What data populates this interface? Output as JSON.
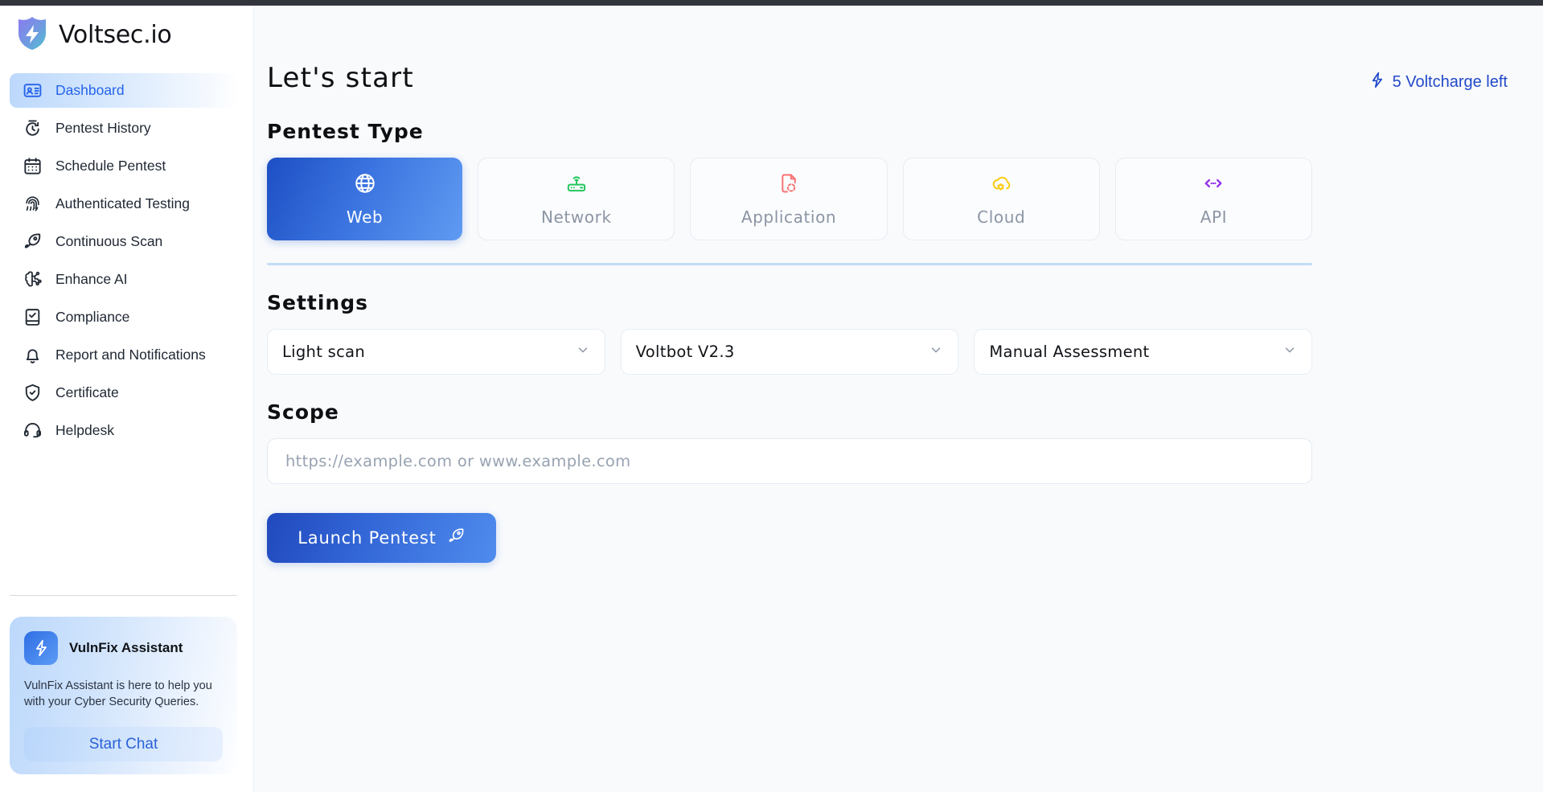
{
  "brand": {
    "name": "Voltsec.io",
    "logo_icon": "shield-bolt-logo"
  },
  "sidebar": {
    "items": [
      {
        "label": "Dashboard",
        "icon": "id-card-icon",
        "active": true
      },
      {
        "label": "Pentest History",
        "icon": "history-clock-icon",
        "active": false
      },
      {
        "label": "Schedule Pentest",
        "icon": "calendar-icon",
        "active": false
      },
      {
        "label": "Authenticated Testing",
        "icon": "fingerprint-icon",
        "active": false
      },
      {
        "label": "Continuous Scan",
        "icon": "rocket-icon",
        "active": false
      },
      {
        "label": "Enhance AI",
        "icon": "brain-circuit-icon",
        "active": false
      },
      {
        "label": "Compliance",
        "icon": "checklist-book-icon",
        "active": false
      },
      {
        "label": "Report and Notifications",
        "icon": "bell-icon",
        "active": false
      },
      {
        "label": "Certificate",
        "icon": "shield-check-icon",
        "active": false
      },
      {
        "label": "Helpdesk",
        "icon": "headset-icon",
        "active": false
      }
    ],
    "assistant": {
      "icon": "bolt-icon",
      "title": "VulnFix Assistant",
      "description": "VulnFix Assistant is here to help you with your Cyber Security Queries.",
      "button_label": "Start Chat"
    }
  },
  "header": {
    "title": "Let's start",
    "voltcharge_label": "5 Voltcharge left",
    "voltcharge_icon": "bolt-icon"
  },
  "pentest_type": {
    "section_title": "Pentest Type",
    "options": [
      {
        "label": "Web",
        "icon": "globe-icon",
        "color": "#ffffff",
        "selected": true
      },
      {
        "label": "Network",
        "icon": "router-wifi-icon",
        "color": "#22c55e",
        "selected": false
      },
      {
        "label": "Application",
        "icon": "file-scan-icon",
        "color": "#f87171",
        "selected": false
      },
      {
        "label": "Cloud",
        "icon": "cloud-cog-icon",
        "color": "#facc15",
        "selected": false
      },
      {
        "label": "API",
        "icon": "code-brackets-icon",
        "color": "#9333ea",
        "selected": false
      }
    ]
  },
  "settings": {
    "section_title": "Settings",
    "selects": [
      {
        "name": "scan-intensity",
        "value": "Light scan"
      },
      {
        "name": "bot-version",
        "value": "Voltbot V2.3"
      },
      {
        "name": "assessment-mode",
        "value": "Manual Assessment"
      }
    ]
  },
  "scope": {
    "section_title": "Scope",
    "placeholder": "https://example.com or www.example.com",
    "value": ""
  },
  "actions": {
    "launch_label": "Launch Pentest",
    "launch_icon": "rocket-icon"
  },
  "theme": {
    "accent": "#2563eb",
    "page_bg": "#f8fafc",
    "sidebar_bg": "#ffffff",
    "divider": "#c3dcf7"
  }
}
